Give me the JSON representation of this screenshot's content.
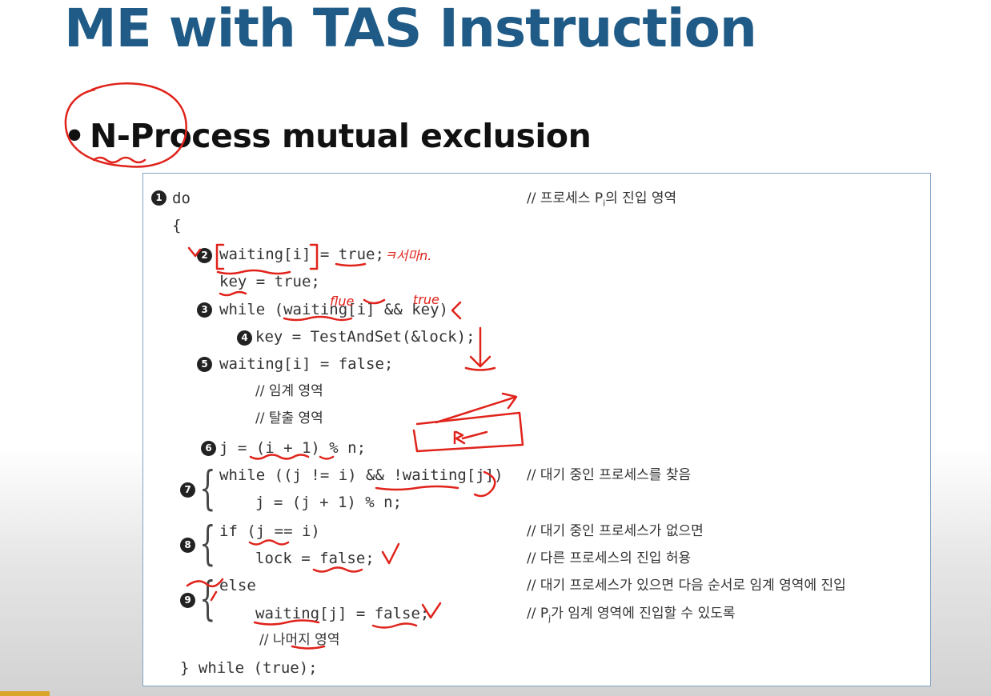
{
  "slide": {
    "title": "ME with TAS Instruction",
    "bullet": "N-Process mutual exclusion"
  },
  "code": {
    "lines": [
      {
        "num": "1",
        "text": "do"
      },
      {
        "text": "{"
      },
      {
        "num": "2",
        "text": "waiting[i] = true;"
      },
      {
        "text": "key = true;"
      },
      {
        "num": "3",
        "text": "while (waiting[i] && key)"
      },
      {
        "num": "4",
        "text": "key = TestAndSet(&lock);"
      },
      {
        "num": "5",
        "text": "waiting[i] = false;"
      },
      {
        "text": "// 임계 영역"
      },
      {
        "text": "// 탈출 영역"
      },
      {
        "num": "6",
        "text": "j = (i + 1) % n;"
      },
      {
        "num": "7",
        "text": "while ((j != i) && !waiting[j])"
      },
      {
        "text": "j = (j + 1) % n;"
      },
      {
        "num": "8",
        "text": "if (j == i)"
      },
      {
        "text": "lock = false;"
      },
      {
        "num": "9",
        "text": "else"
      },
      {
        "text": "waiting[j] = false;"
      },
      {
        "text": "// 나머지 영역"
      },
      {
        "text": "} while (true);"
      }
    ],
    "comments": {
      "entry_prefix": "// 프로세스 P",
      "entry_sub": "i",
      "entry_suffix": "의 진입 영역",
      "find_waiting": "// 대기 중인 프로세스를 찾음",
      "none_waiting": "// 대기 중인 프로세스가 없으면",
      "allow_other": "// 다른 프로세스의 진입 허용",
      "next_order": "// 대기 프로세스가 있으면 다음 순서로 임계 영역에 진입",
      "pj_prefix": "// P",
      "pj_sub": "j",
      "pj_suffix": "가 임계 영역에 진입할 수 있도록"
    }
  },
  "annotations": {
    "ink_color": "#e0231b",
    "notes": [
      "ㅋ서마n.",
      "flue",
      "true"
    ]
  },
  "colors": {
    "title": "#1f5b86",
    "box_border": "#7fa3c4",
    "corner_mark": "#d9a52a"
  }
}
